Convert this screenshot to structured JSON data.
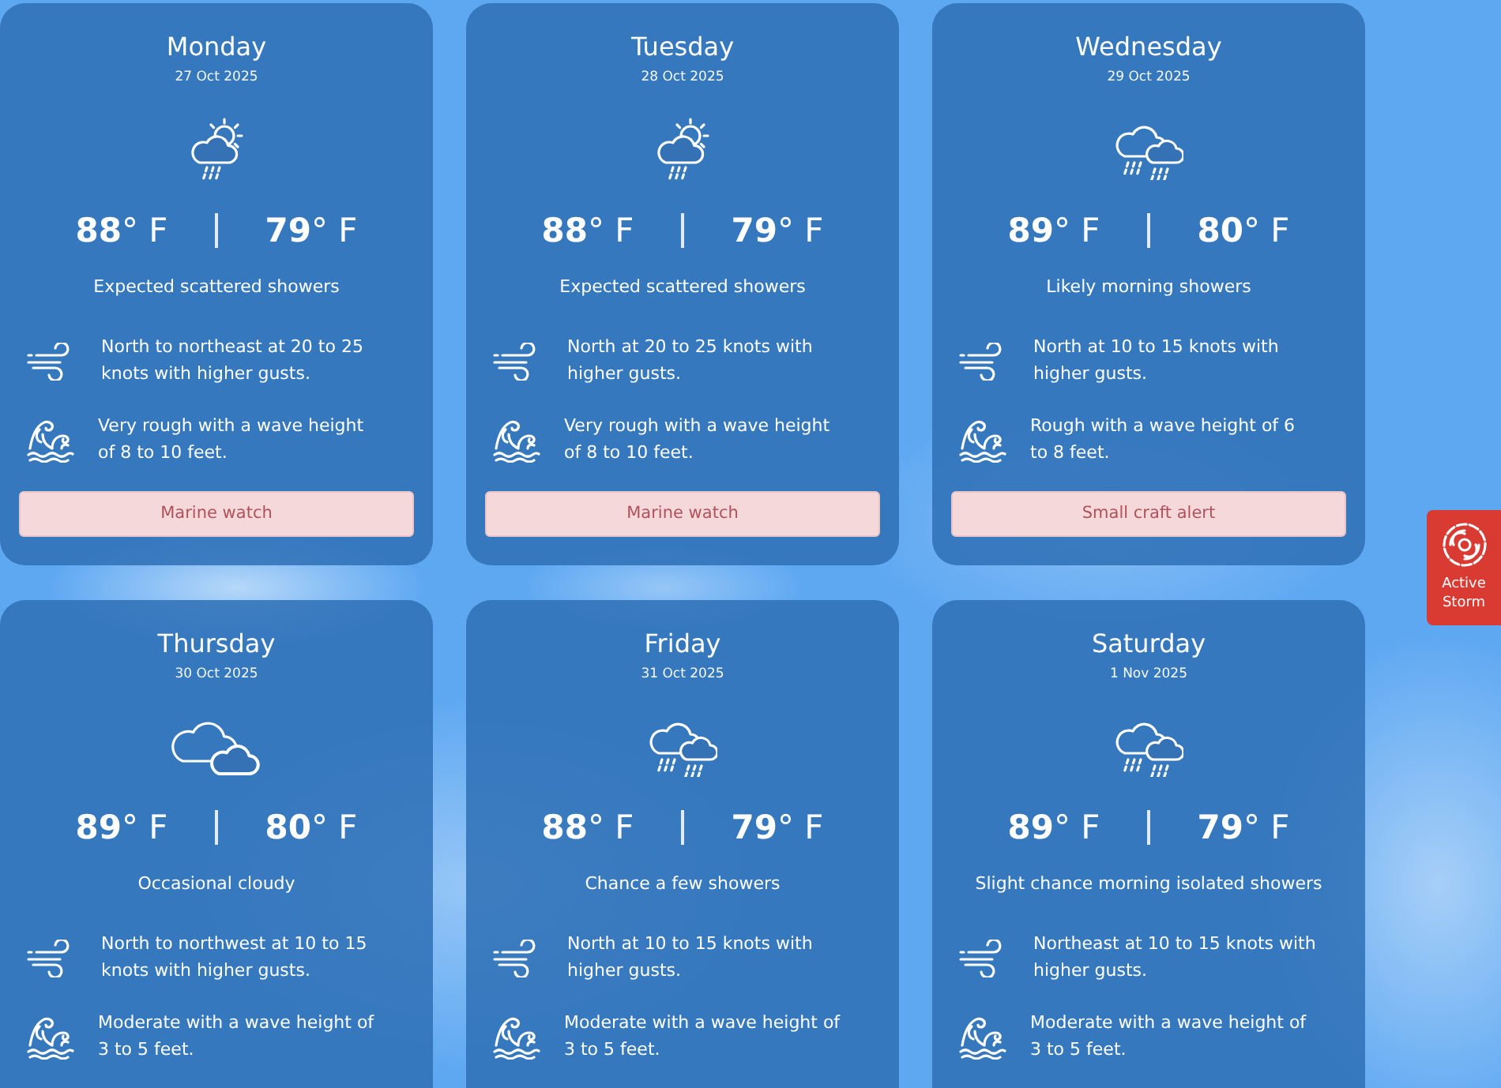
{
  "days": [
    {
      "day": "Monday",
      "date": "27 Oct 2025",
      "kind": "sun_showers",
      "high": "**88**° F",
      "low": "**79**° F",
      "summary": "Expected scattered showers",
      "wind": "North to northeast at 20 to 25 knots with higher gusts.",
      "seas": "Very rough with a wave height of 8 to 10 feet.",
      "alert": "Marine watch"
    },
    {
      "day": "Tuesday",
      "date": "28 Oct 2025",
      "kind": "sun_showers",
      "high": "**88**° F",
      "low": "**79**° F",
      "summary": "Expected scattered showers",
      "wind": "North at 20 to 25 knots with higher gusts.",
      "seas": "Very rough with a wave height of 8 to 10 feet.",
      "alert": "Marine watch"
    },
    {
      "day": "Wednesday",
      "date": "29 Oct 2025",
      "kind": "showers",
      "high": "**89**° F",
      "low": "**80**° F",
      "summary": "Likely morning showers",
      "wind": "North at 10 to 15 knots with higher gusts.",
      "seas": "Rough with a wave height of 6 to 8 feet.",
      "alert": "Small craft alert"
    },
    {
      "day": "Thursday",
      "date": "30 Oct 2025",
      "kind": "cloudy",
      "high": "**89**° F",
      "low": "**80**° F",
      "summary": "Occasional cloudy",
      "wind": "North to northwest at 10 to 15 knots with higher gusts.",
      "seas": "Moderate with a wave height of 3 to 5 feet."
    },
    {
      "day": "Friday",
      "date": "31 Oct 2025",
      "kind": "showers",
      "high": "**88**° F",
      "low": "**79**° F",
      "summary": "Chance a few showers",
      "wind": "North at 10 to 15 knots with higher gusts.",
      "seas": "Moderate with a wave height of 3 to 5 feet."
    },
    {
      "day": "Saturday",
      "date": "1 Nov 2025",
      "kind": "showers",
      "high": "**89**° F",
      "low": "**79**° F",
      "summary": "Slight chance morning isolated showers",
      "wind": "Northeast at 10 to 15 knots with higher gusts.",
      "seas": "Moderate with a wave height of 3 to 5 feet."
    }
  ],
  "storm_badge": {
    "label": "Active Storm"
  }
}
